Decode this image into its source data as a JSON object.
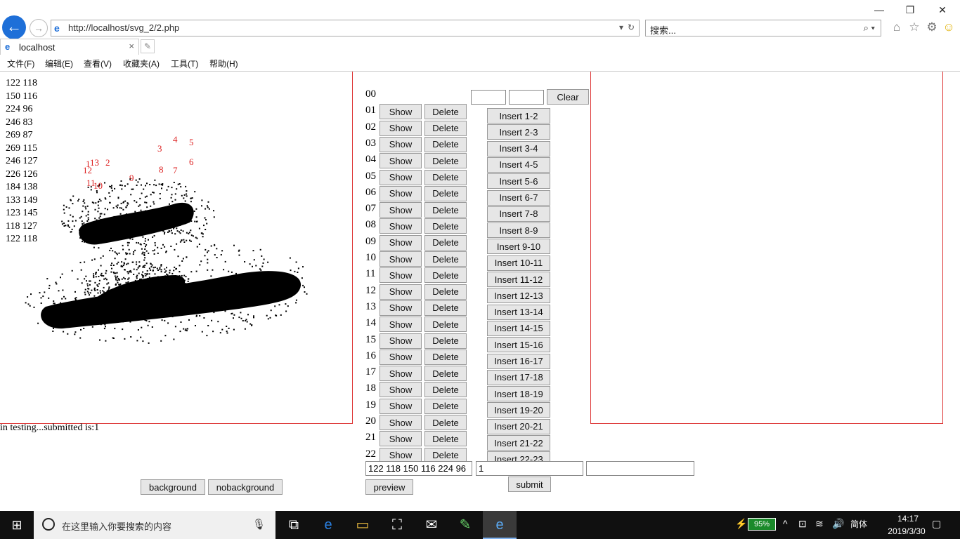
{
  "window": {
    "minimize": "—",
    "restore": "❐",
    "close": "✕"
  },
  "nav": {
    "back_icon": "arrow-left",
    "forward_icon": "arrow-right",
    "url": "http://localhost/svg_2/2.php",
    "search_placeholder": "搜索...",
    "search_icon": "magnifier"
  },
  "tab": {
    "title": "localhost",
    "close": "×"
  },
  "menu": [
    "文件(F)",
    "编辑(E)",
    "查看(V)",
    "收藏夹(A)",
    "工具(T)",
    "帮助(H)"
  ],
  "coords": [
    "122 118",
    "150 116",
    "224 96",
    "246 83",
    "269 87",
    "269 115",
    "246 127",
    "226 126",
    "184 138",
    "133 149",
    "123 145",
    "118 127",
    "122 118"
  ],
  "status_text": "in testing...submitted is:1",
  "row_labels": [
    "00",
    "01",
    "02",
    "03",
    "04",
    "05",
    "06",
    "07",
    "08",
    "09",
    "10",
    "11",
    "12",
    "13",
    "14",
    "15",
    "16",
    "17",
    "18",
    "19",
    "20",
    "21",
    "22"
  ],
  "show_label": "Show",
  "delete_label": "Delete",
  "clear_label": "Clear",
  "insert_labels": [
    "Insert 1-2",
    "Insert 2-3",
    "Insert 3-4",
    "Insert 4-5",
    "Insert 5-6",
    "Insert 6-7",
    "Insert 7-8",
    "Insert 8-9",
    "Insert 9-10",
    "Insert 10-11",
    "Insert 11-12",
    "Insert 12-13",
    "Insert 13-14",
    "Insert 14-15",
    "Insert 15-16",
    "Insert 16-17",
    "Insert 17-18",
    "Insert 18-19",
    "Insert 19-20",
    "Insert 20-21",
    "Insert 21-22",
    "Insert 22-23"
  ],
  "bottom": {
    "coords_value": "122 118 150 116 224 96",
    "count_value": "1",
    "extra_value": "",
    "preview_label": "preview",
    "submit_label": "submit",
    "background_label": "background",
    "nobackground_label": "nobackground"
  },
  "taskbar": {
    "search_placeholder": "在这里输入你要搜索的内容",
    "battery": "95%",
    "ime": "简体",
    "time": "14:17",
    "date": "2019/3/30"
  },
  "point_labels": [
    "1",
    "2",
    "3",
    "4",
    "5",
    "6",
    "7",
    "8",
    "9",
    "10",
    "11",
    "12",
    "13"
  ]
}
